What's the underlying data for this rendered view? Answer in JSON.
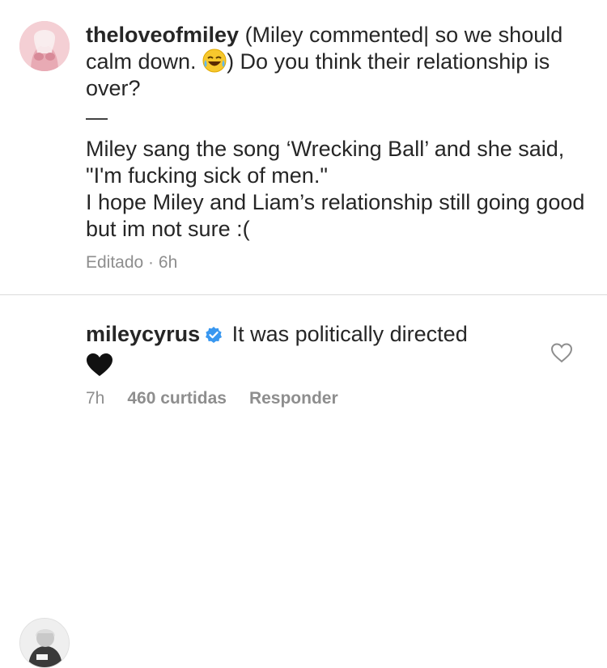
{
  "comment1": {
    "username": "theloveofmiley",
    "text_line1": " (Miley commented| so we should calm down. ",
    "text_line1b": ") Do you think their relationship is over?",
    "dash": "—",
    "para2": "Miley sang the song ‘Wrecking Ball’  and she said, \"I'm fucking sick of men.\"",
    "para3": "I hope Miley and Liam’s relationship still going good but im not sure :(",
    "meta": "Editado · 6h",
    "emoji": "laughing-crying-emoji"
  },
  "comment2": {
    "username": "mileycyrus",
    "text": " It was politically directed",
    "time": "7h",
    "likes": "460 curtidas",
    "reply": "Responder",
    "verified_color": "#3897f0",
    "emoji": "black-heart-emoji"
  }
}
